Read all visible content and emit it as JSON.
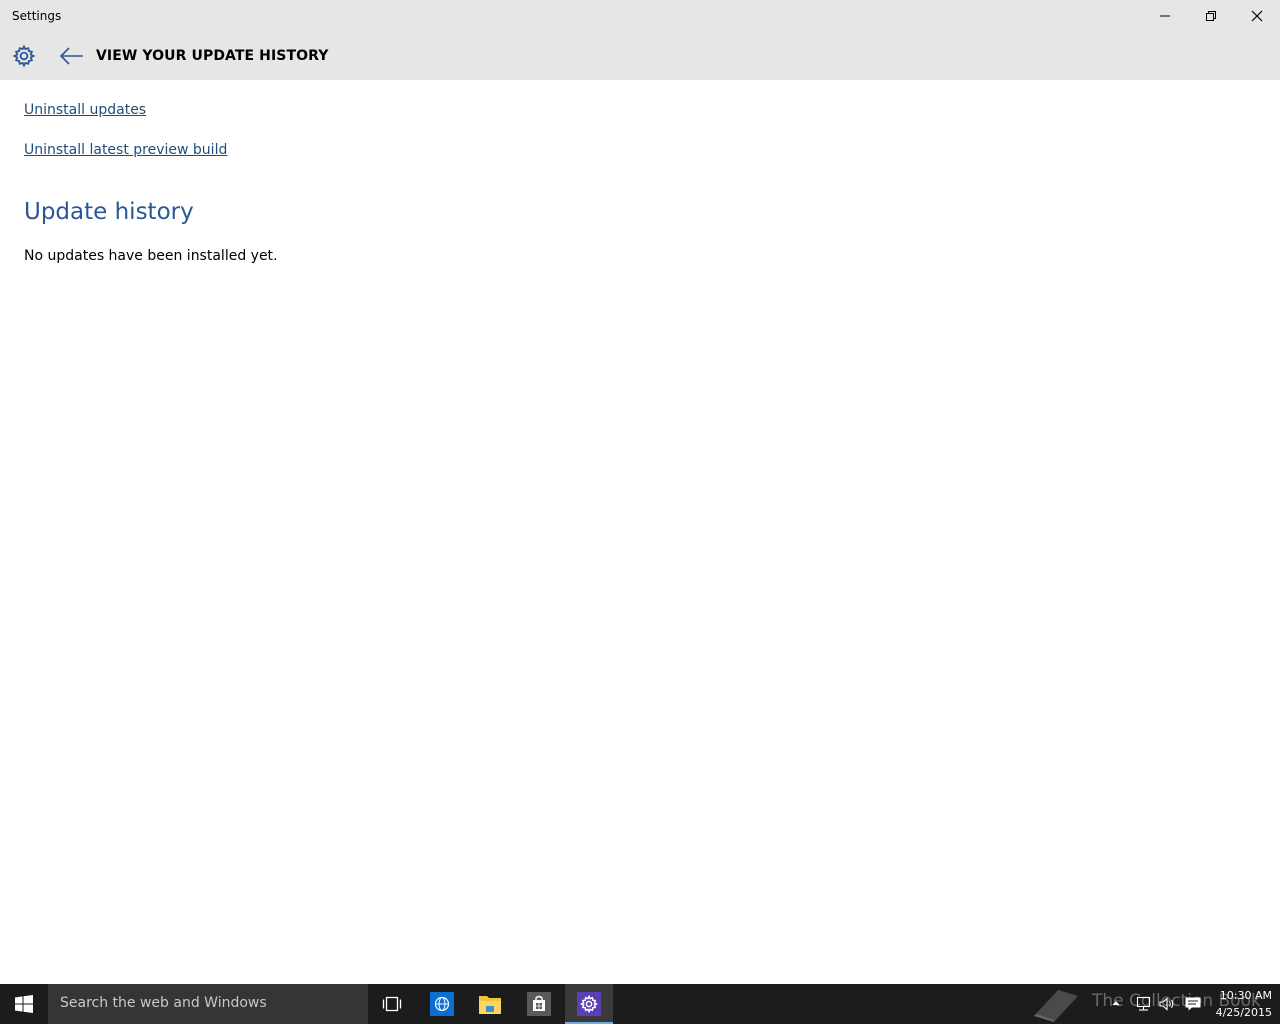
{
  "window": {
    "title": "Settings",
    "controls": [
      "minimize",
      "restore",
      "close"
    ]
  },
  "header": {
    "app_icon": "gear-icon",
    "back_icon": "back-arrow-icon",
    "page_title": "VIEW YOUR UPDATE HISTORY"
  },
  "content": {
    "links": [
      {
        "label": "Uninstall updates"
      },
      {
        "label": "Uninstall latest preview build"
      }
    ],
    "section_title": "Update history",
    "empty_message": "No updates have been installed yet."
  },
  "taskbar": {
    "search_placeholder": "Search the web and Windows",
    "pinned": [
      "task-view-icon",
      "internet-explorer-icon",
      "file-explorer-icon",
      "store-icon",
      "settings-icon"
    ],
    "active_app": "settings-icon",
    "watermark": "The Collection Book",
    "tray_icons": [
      "show-hidden-icons-icon",
      "network-icon",
      "volume-icon",
      "action-center-icon"
    ],
    "time": "10:30 AM",
    "date": "4/25/2015"
  },
  "colors": {
    "titlebar_bg": "#e6e6e6",
    "link": "#1f4e79",
    "section_title": "#2b5797",
    "taskbar_bg": "#1c1c1c",
    "searchbox_bg": "#353535",
    "active_indicator": "#76a9e0"
  }
}
